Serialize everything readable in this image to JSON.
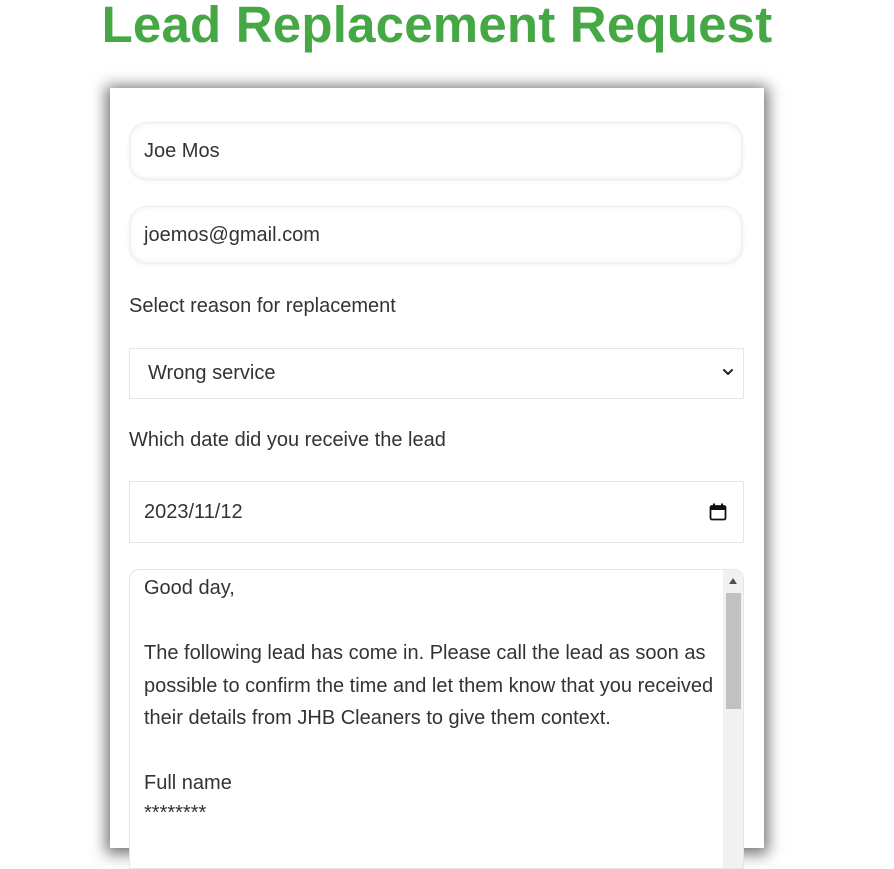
{
  "page": {
    "title": "Lead Replacement Request"
  },
  "form": {
    "name_value": "Joe Mos",
    "email_value": "joemos@gmail.com",
    "reason_label": "Select reason for replacement",
    "reason_selected": "Wrong service",
    "date_label": "Which date did you receive the lead",
    "date_value": "2023/11/12",
    "message": {
      "greeting": "Good day,",
      "body": "The following lead has come in. Please call the lead as soon as possible to confirm the time and let them know that you received their details from JHB Cleaners to give them context.",
      "field_label": "Full name",
      "field_value": "********"
    }
  },
  "colors": {
    "title": "#45a845",
    "scroll_thumb": "#c1c1c1"
  },
  "icons": {
    "select": "chevron-down-icon",
    "date": "calendar-icon",
    "scroll": "scroll-up-arrow-icon"
  }
}
